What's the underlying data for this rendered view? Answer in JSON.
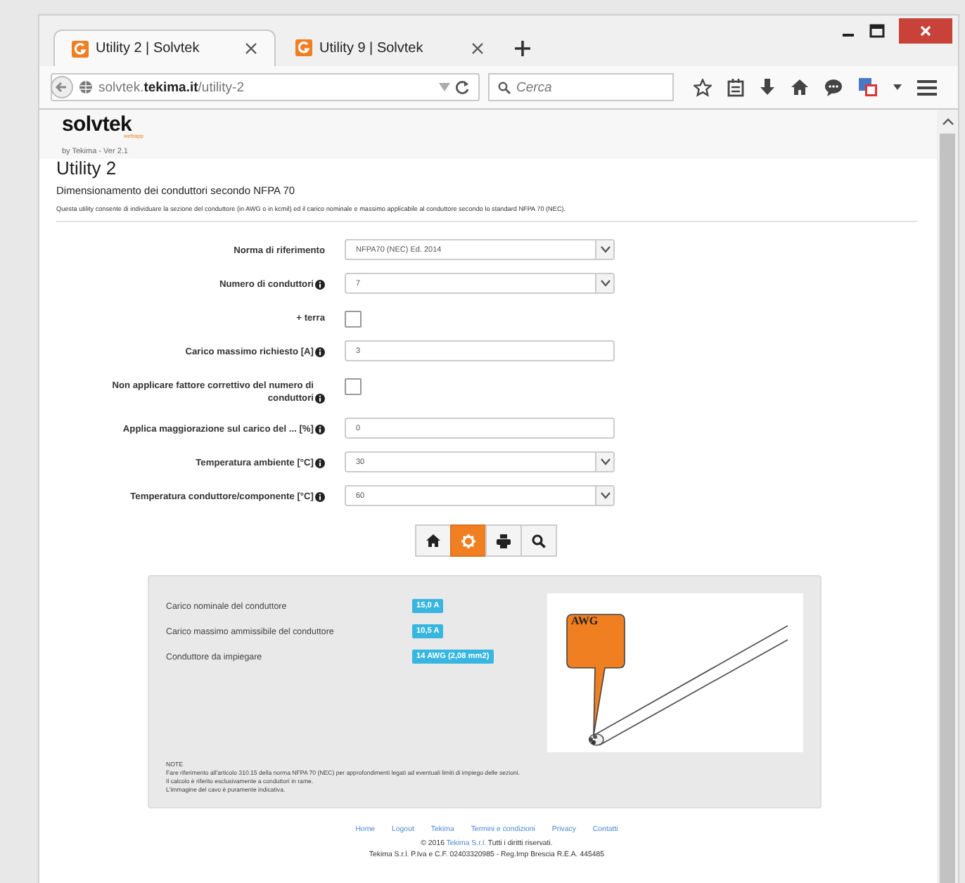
{
  "tabs": [
    {
      "title": "Utility 2 | Solvtek",
      "selected": true
    },
    {
      "title": "Utility 9 | Solvtek",
      "selected": false
    }
  ],
  "address": "solvtek.**tekima.it**/utility-2",
  "search": {
    "placeholder": "Cerca"
  },
  "site": {
    "logo": "solvtek",
    "logo_sub": "webapp",
    "version": "by Tekima - Ver 2.1"
  },
  "page": {
    "title": "Utility 2",
    "subtitle": "Dimensionamento dei conduttori secondo NFPA 70",
    "description": "Questa utility consente di individuare la sezione del conduttore (in AWG o in kcmil) ed il carico nominale e massimo applicabile al conduttore secondo lo standard NFPA 70 (NEC)."
  },
  "form": [
    {
      "label": "Norma di riferimento",
      "info": false,
      "kind": "select",
      "value": "NFPA70 (NEC) Ed. 2014"
    },
    {
      "label": "Numero di conduttori",
      "info": true,
      "kind": "select",
      "value": "7"
    },
    {
      "label": "+ terra",
      "info": false,
      "kind": "checkbox",
      "checked": false
    },
    {
      "label": "Carico massimo richiesto [A]",
      "info": true,
      "kind": "text",
      "value": "3"
    },
    {
      "label": "Non applicare fattore correttivo del numero di conduttori",
      "info": true,
      "kind": "checkbox",
      "checked": false
    },
    {
      "label": "Applica maggiorazione sul carico del ... [%]",
      "info": true,
      "kind": "text",
      "value": "0"
    },
    {
      "label": "Temperatura ambiente [°C]",
      "info": true,
      "kind": "select",
      "value": "30"
    },
    {
      "label": "Temperatura conduttore/componente [°C]",
      "info": true,
      "kind": "select",
      "value": "60"
    }
  ],
  "toolbar": [
    {
      "kind": "home",
      "selected": false
    },
    {
      "kind": "settings",
      "selected": true
    },
    {
      "kind": "print",
      "selected": false
    },
    {
      "kind": "search",
      "selected": false
    }
  ],
  "results": [
    {
      "label": "Carico nominale del conduttore",
      "value": "15,0 A"
    },
    {
      "label": "Carico massimo ammissibile del conduttore",
      "value": "10,5 A"
    },
    {
      "label": "Conduttore da impiegare",
      "value": "14 AWG (2,08 mm2)"
    }
  ],
  "image_label": "AWG",
  "notes": {
    "title": "NOTE",
    "lines": [
      "Fare riferimento all'articolo 310.15 della norma NFPA 70 (NEC) per approfondimenti legati ad eventuali limiti di impiego delle sezioni.",
      "Il calcolo è riferito esclusivamente a conduttori in rame.",
      "L'immagine del cavo è puramente indicativa."
    ]
  },
  "footer": {
    "links": [
      "Home",
      "Logout",
      "Tekima",
      "Termini e condizioni",
      "Privacy",
      "Contatti"
    ],
    "copyright_pre": "© 2016",
    "copyright_link": "Tekima S.r.l.",
    "copyright_post": "Tutti i diritti riservati.",
    "company": "Tekima S.r.l. P.Iva e C.F. 02403320985 - Reg.Imp Brescia R.E.A. 445485"
  }
}
